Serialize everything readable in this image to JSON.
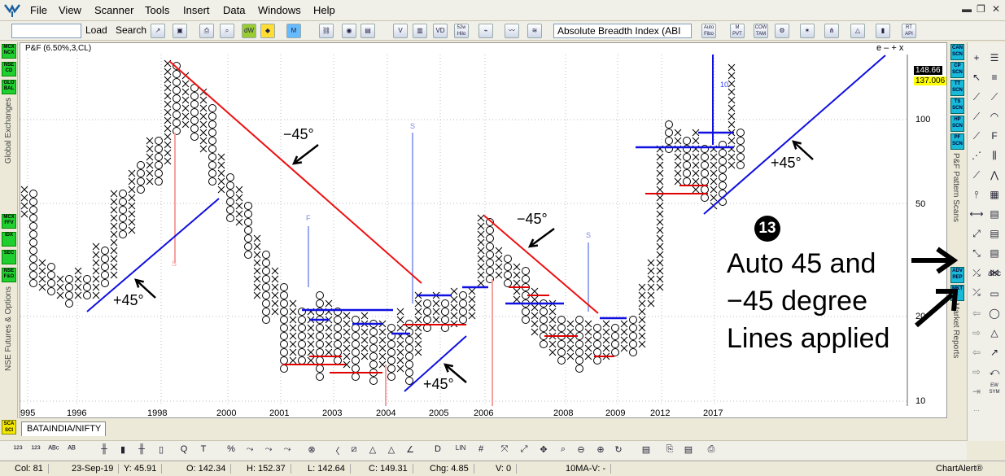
{
  "menu": [
    "File",
    "View",
    "Scanner",
    "Tools",
    "Insert",
    "Data",
    "Windows",
    "Help"
  ],
  "toolbar": {
    "load": "Load",
    "search": "Search",
    "indicator": "Absolute Breadth Index (ABI",
    "buttons": [
      "52w Hilo",
      "Auto Fibo",
      "M PVT",
      "COW TAM",
      "RT API"
    ]
  },
  "left_buttons": [
    "MCX NCX",
    "NSE CD",
    "GLO BAL",
    "MCX FFV",
    "IDX",
    "SEC",
    "NSE F&O"
  ],
  "left_labels": {
    "global": "Global Exchanges",
    "futures": "NSE Futures & Options"
  },
  "chart": {
    "title": "P&F (6.50%,3,CL)",
    "window_ctl": "e – + x",
    "price_tags": [
      "148.66",
      "137.006"
    ],
    "y_ticks": [
      "100",
      "50",
      "20",
      "10"
    ],
    "x_ticks": [
      "995",
      "1996",
      "1998",
      "2000",
      "2001",
      "2003",
      "2004",
      "2005",
      "2006",
      "2008",
      "2009",
      "2012",
      "2017"
    ],
    "annotations": {
      "neg45": "−45°",
      "pos45": "+45°",
      "badge": "13",
      "line1": "Auto 45 and",
      "line2": "−45 degree",
      "line3": "Lines applied"
    },
    "markers": [
      "S",
      "F",
      "S",
      "S",
      "10"
    ]
  },
  "right_scan": [
    "CAN SCN",
    "CP SCN",
    "TT SCN",
    "TS SCN",
    "HP SCN",
    "PF SCN",
    "ADV REP",
    "MKT"
  ],
  "right_labels": {
    "pattern": "P&F Pattern Scans",
    "reports": "Market Reports"
  },
  "draw_tools": {
    "abc": "abc",
    "ew": "EW SYM"
  },
  "symbol_tab": "BATAINDIA/NIFTY",
  "scanner_btn": "SCA SCI",
  "status": {
    "col": "Col: 81",
    "date": "23-Sep-19",
    "y": "Y: 45.91",
    "o": "O: 142.34",
    "h": "H: 152.37",
    "l": "L: 142.64",
    "c": "C: 149.31",
    "chg": "Chg: 4.85",
    "v": "V: 0",
    "ma": "10MA-V: -",
    "brand": "ChartAlert®"
  }
}
